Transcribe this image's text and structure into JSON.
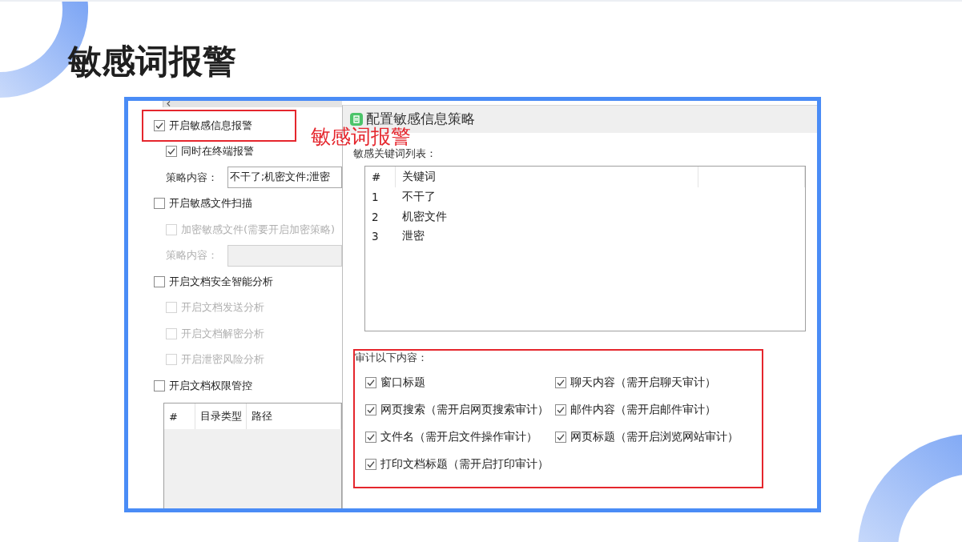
{
  "title": "敏感词报警",
  "settings_panel": {
    "items": [
      {
        "kind": "checkbox",
        "label": "开启敏感信息报警",
        "checked": true,
        "disabled": false,
        "highlighted": true,
        "children": [
          {
            "kind": "checkbox",
            "label": "同时在终端报警",
            "checked": true,
            "disabled": false
          },
          {
            "kind": "field",
            "label": "策略内容：",
            "value": "不干了;机密文件;泄密",
            "disabled": false
          }
        ]
      },
      {
        "kind": "checkbox",
        "label": "开启敏感文件扫描",
        "checked": false,
        "disabled": false,
        "highlighted": false,
        "children": [
          {
            "kind": "checkbox",
            "label": "加密敏感文件(需要开启加密策略)",
            "checked": false,
            "disabled": true
          },
          {
            "kind": "field",
            "label": "策略内容：",
            "disabled": true
          }
        ]
      },
      {
        "kind": "checkbox",
        "label": "开启文档安全智能分析",
        "checked": false,
        "disabled": false,
        "highlighted": false,
        "children": [
          {
            "kind": "checkbox",
            "label": "开启文档发送分析",
            "checked": false,
            "disabled": true
          },
          {
            "kind": "checkbox",
            "label": "开启文档解密分析",
            "checked": false,
            "disabled": true
          },
          {
            "kind": "checkbox",
            "label": "开启泄密风险分析",
            "checked": false,
            "disabled": true
          }
        ]
      },
      {
        "kind": "checkbox",
        "label": "开启文档权限管控",
        "checked": false,
        "disabled": false,
        "highlighted": false,
        "children": [
          {
            "kind": "table",
            "columns": [
              "#",
              "目录类型",
              "路径"
            ]
          }
        ]
      }
    ]
  },
  "annotation": {
    "text": "敏感词报警"
  },
  "dialog": {
    "title": "配置敏感信息策略",
    "keyword_list": {
      "label": "敏感关键词列表：",
      "columns": [
        "#",
        "关键词"
      ],
      "rows": [
        [
          "1",
          "不干了"
        ],
        [
          "2",
          "机密文件"
        ],
        [
          "3",
          "泄密"
        ]
      ]
    },
    "audit": {
      "label": "审计以下内容：",
      "highlighted": true,
      "options": [
        {
          "label": "窗口标题",
          "checked": true
        },
        {
          "label": "聊天内容（需开启聊天审计）",
          "checked": true
        },
        {
          "label": "网页搜索（需开启网页搜索审计）",
          "checked": true
        },
        {
          "label": "邮件内容（需开启邮件审计）",
          "checked": true
        },
        {
          "label": "文件名（需开启文件操作审计）",
          "checked": true
        },
        {
          "label": "网页标题（需开启浏览网站审计）",
          "checked": true
        },
        {
          "label": "打印文档标题（需开启打印审计）",
          "checked": true
        }
      ]
    }
  }
}
